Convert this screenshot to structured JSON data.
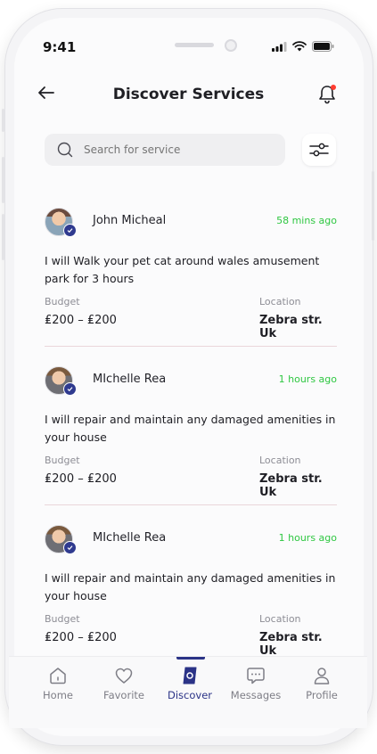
{
  "status_bar": {
    "time": "9:41"
  },
  "header": {
    "title": "Discover Services"
  },
  "search": {
    "placeholder": "Search for service"
  },
  "posts": [
    {
      "name": "John Micheal",
      "time_ago": "58 mins ago",
      "description": "I will Walk your pet cat around wales amusement park for 3 hours",
      "budget_label": "Budget",
      "budget": "₤200 – ₤200",
      "location_label": "Location",
      "location": "Zebra str. Uk"
    },
    {
      "name": "MIchelle Rea",
      "time_ago": "1 hours ago",
      "description": "I will repair and maintain any damaged amenities in your house",
      "budget_label": "Budget",
      "budget": "₤200 – ₤200",
      "location_label": "Location",
      "location": "Zebra str. Uk"
    },
    {
      "name": "MIchelle Rea",
      "time_ago": "1 hours ago",
      "description": "I will repair and maintain any damaged amenities in your house",
      "budget_label": "Budget",
      "budget": "₤200 – ₤200",
      "location_label": "Location",
      "location": "Zebra str. Uk"
    }
  ],
  "tab_bar": {
    "active": "Discover",
    "items": [
      {
        "label": "Home",
        "icon": "home-icon"
      },
      {
        "label": "Favorite",
        "icon": "heart-icon"
      },
      {
        "label": "Discover",
        "icon": "compass-icon"
      },
      {
        "label": "Messages",
        "icon": "chat-bubble-icon"
      },
      {
        "label": "Profile",
        "icon": "user-icon"
      }
    ]
  },
  "colors": {
    "accent": "#2b3387",
    "time_green": "#2fc742",
    "notification_dot": "#ff3b30",
    "divider": "#ead6da"
  }
}
